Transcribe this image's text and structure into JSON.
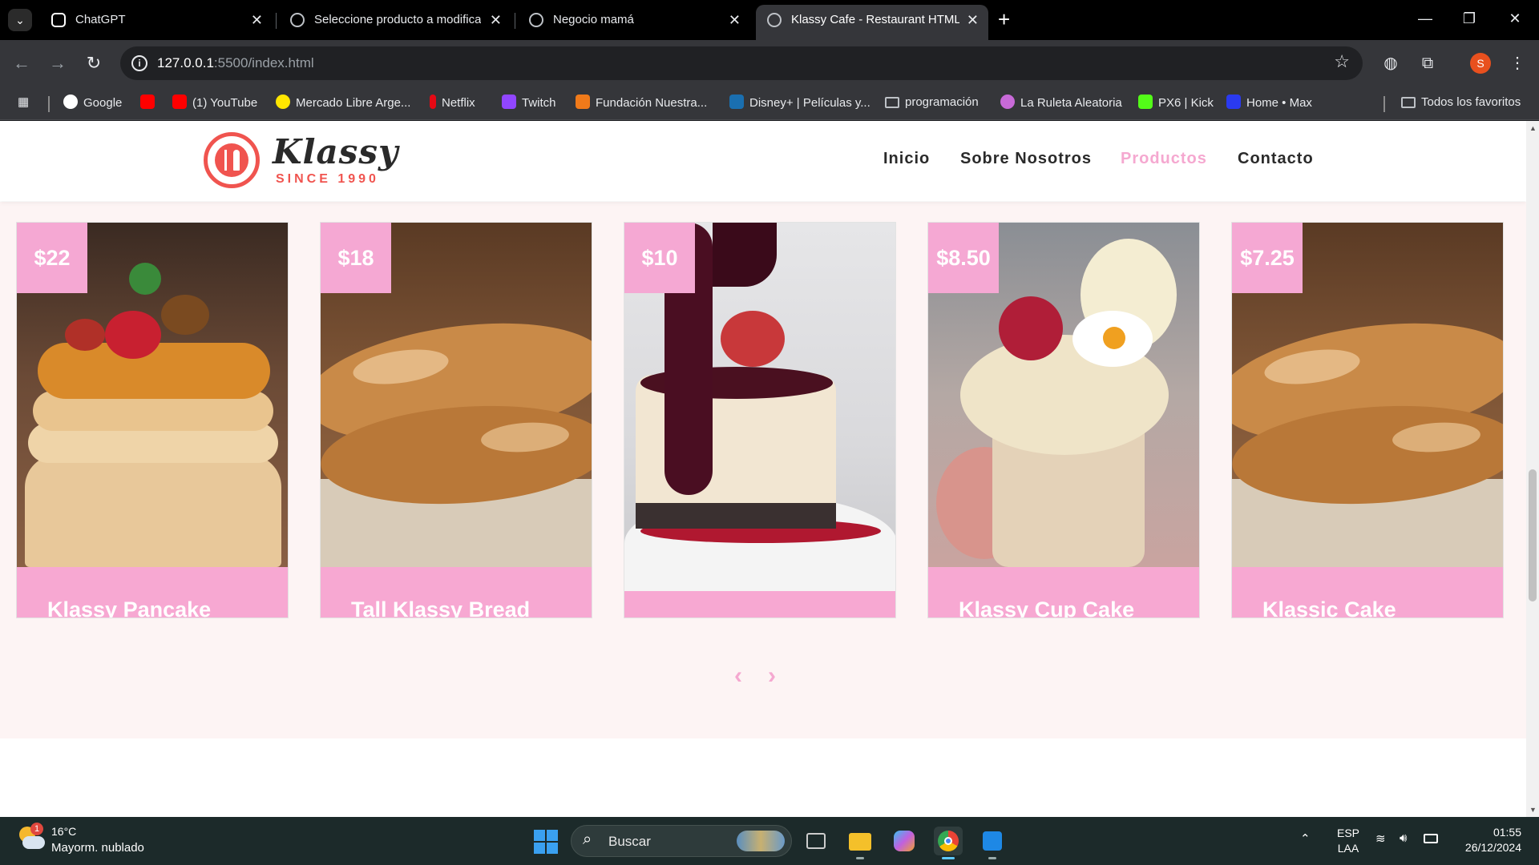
{
  "browser": {
    "tabs": [
      {
        "title": "ChatGPT",
        "active": false
      },
      {
        "title": "Seleccione producto a modifica",
        "active": false
      },
      {
        "title": "Negocio mamá",
        "active": false
      },
      {
        "title": "Klassy Cafe - Restaurant HTML T",
        "active": true
      }
    ],
    "url_host": "127.0.0.1",
    "url_path": ":5500/index.html",
    "profile_initial": "S",
    "bookmarks": [
      {
        "label": "Google",
        "icon": "google-icon",
        "color": "#4285f4"
      },
      {
        "label": "",
        "icon": "youtube-icon",
        "color": "#ff0000"
      },
      {
        "label": "(1) YouTube",
        "icon": "youtube-icon",
        "color": "#ff0000"
      },
      {
        "label": "Mercado Libre Arge...",
        "icon": "mercadolibre-icon",
        "color": "#ffe600"
      },
      {
        "label": "Netflix",
        "icon": "netflix-icon",
        "color": "#e50914"
      },
      {
        "label": "Twitch",
        "icon": "twitch-icon",
        "color": "#9146ff"
      },
      {
        "label": "Fundación Nuestra...",
        "icon": "fundacion-icon",
        "color": "#f07a1a"
      },
      {
        "label": "Disney+ | Películas y...",
        "icon": "disney-icon",
        "color": "#1a6fb0"
      },
      {
        "label": "programación",
        "icon": "folder-icon",
        "color": "#bdc1c6"
      },
      {
        "label": "La Ruleta Aleatoria",
        "icon": "ruleta-icon",
        "color": "#c86ad8"
      },
      {
        "label": "PX6 | Kick",
        "icon": "kick-icon",
        "color": "#53fc18"
      },
      {
        "label": "Home • Max",
        "icon": "max-icon",
        "color": "#2a3af0"
      }
    ],
    "all_bookmarks": "Todos los favoritos"
  },
  "site": {
    "logo_word": "Klassy",
    "logo_since": "SINCE 1990",
    "nav": [
      {
        "label": "Inicio",
        "active": false
      },
      {
        "label": "Sobre Nosotros",
        "active": false
      },
      {
        "label": "Productos",
        "active": true
      },
      {
        "label": "Contacto",
        "active": false
      }
    ],
    "accent_color": "#f5a8d0",
    "products": [
      {
        "price": "$22",
        "name": "Klassy Pancake",
        "image": "pancake-stack"
      },
      {
        "price": "$18",
        "name": "Tall Klassy Bread",
        "image": "bread-loaf"
      },
      {
        "price": "$10",
        "name": "",
        "image": "cheesecake-berry-sauce"
      },
      {
        "price": "$8.50",
        "name": "Klassy Cup Cake",
        "image": "cupcake-raspberry"
      },
      {
        "price": "$7.25",
        "name": "Klassic Cake",
        "image": "bread-loaf"
      }
    ],
    "carousel_prev": "‹",
    "carousel_next": "›"
  },
  "taskbar": {
    "weather_temp": "16°C",
    "weather_desc": "Mayorm. nublado",
    "weather_badge": "1",
    "search_label": "Buscar",
    "lang_top": "ESP",
    "lang_bottom": "LAA",
    "time": "01:55",
    "date": "26/12/2024"
  }
}
